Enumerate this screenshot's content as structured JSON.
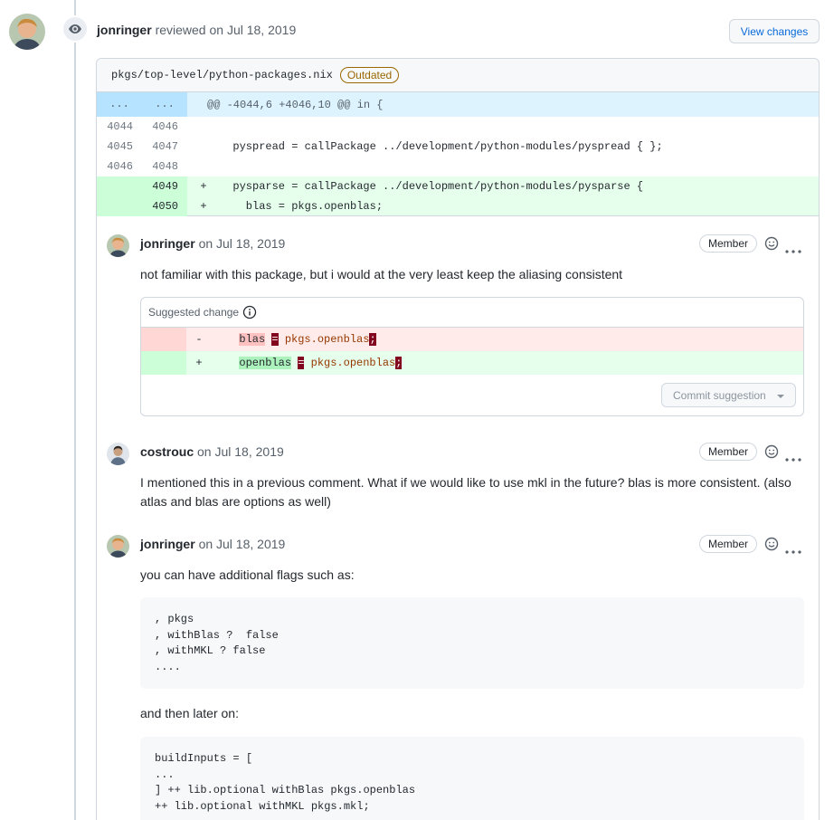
{
  "review": {
    "author": "jonringer",
    "action_text": "reviewed on Jul 18, 2019",
    "view_changes_label": "View changes"
  },
  "file": {
    "path": "pkgs/top-level/python-packages.nix",
    "outdated_label": "Outdated"
  },
  "diff": {
    "hunk": {
      "left": "...",
      "right": "...",
      "text": "@@ -4044,6 +4046,10 @@ in {"
    },
    "rows": [
      {
        "old": "4044",
        "new": "4046",
        "sign": "",
        "code": "",
        "type": "context"
      },
      {
        "old": "4045",
        "new": "4047",
        "sign": "",
        "code": "  pyspread = callPackage ../development/python-modules/pyspread { };",
        "type": "context"
      },
      {
        "old": "4046",
        "new": "4048",
        "sign": "",
        "code": "",
        "type": "context"
      },
      {
        "old": "",
        "new": "4049",
        "sign": "+",
        "code": "  pysparse = callPackage ../development/python-modules/pysparse {",
        "type": "add"
      },
      {
        "old": "",
        "new": "4050",
        "sign": "+",
        "code": "    blas = pkgs.openblas;",
        "type": "add"
      }
    ]
  },
  "comments": [
    {
      "author": "jonringer",
      "date": "on Jul 18, 2019",
      "role": "Member",
      "body": "not familiar with this package, but i would at the very least keep the aliasing consistent",
      "suggestion": {
        "title": "Suggested change",
        "del_sign": "-",
        "del_token": "blas",
        "del_eq": "=",
        "del_rest": " pkgs.openblas",
        "del_end": ";",
        "ins_sign": "+",
        "ins_token": "openblas",
        "ins_eq": "=",
        "ins_rest": " pkgs.openblas",
        "ins_end": ";",
        "commit_label": "Commit suggestion"
      }
    },
    {
      "author": "costrouc",
      "date": "on Jul 18, 2019",
      "role": "Member",
      "body": "I mentioned this in a previous comment. What if we would like to use mkl in the future? blas is more consistent. (also atlas and blas are options as well)"
    },
    {
      "author": "jonringer",
      "date": "on Jul 18, 2019",
      "role": "Member",
      "body": "you can have additional flags such as:",
      "code1": ", pkgs\n, withBlas ?  false\n, withMKL ? false\n....",
      "body2": "and then later on:",
      "code2": "buildInputs = [\n...\n] ++ lib.optional withBlas pkgs.openblas\n++ lib.optional withMKL pkgs.mkl;"
    }
  ],
  "icons": [
    "eye-icon",
    "info-icon",
    "smiley-icon",
    "kebab-horizontal-icon",
    "triangle-down-icon"
  ]
}
